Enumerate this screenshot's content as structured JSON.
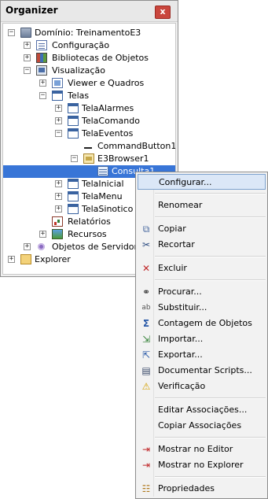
{
  "panel": {
    "title": "Organizer",
    "close_label": "x"
  },
  "tree": [
    {
      "label": "Domínio: TreinamentoE3",
      "expander": "−",
      "icon": "domain-icon"
    },
    {
      "label": "Configuração",
      "expander": "+",
      "icon": "config-icon"
    },
    {
      "label": "Bibliotecas de Objetos",
      "expander": "+",
      "icon": "library-icon"
    },
    {
      "label": "Visualização",
      "expander": "−",
      "icon": "visualization-icon"
    },
    {
      "label": "Viewer e Quadros",
      "expander": "+",
      "icon": "viewer-icon"
    },
    {
      "label": "Telas",
      "expander": "−",
      "icon": "screens-icon"
    },
    {
      "label": "TelaAlarmes",
      "expander": "+",
      "icon": "screen-icon"
    },
    {
      "label": "TelaComando",
      "expander": "+",
      "icon": "screen-icon"
    },
    {
      "label": "TelaEventos",
      "expander": "−",
      "icon": "screen-icon"
    },
    {
      "label": "CommandButton1",
      "expander": "",
      "icon": "command-button-icon"
    },
    {
      "label": "E3Browser1",
      "expander": "−",
      "icon": "browser-icon"
    },
    {
      "label": "Consulta1",
      "expander": "",
      "icon": "query-icon",
      "selected": true
    },
    {
      "label": "TelaInicial",
      "expander": "+",
      "icon": "screen-icon"
    },
    {
      "label": "TelaMenu",
      "expander": "+",
      "icon": "screen-icon"
    },
    {
      "label": "TelaSinotico",
      "expander": "+",
      "icon": "screen-icon"
    },
    {
      "label": "Relatórios",
      "expander": "",
      "icon": "report-icon"
    },
    {
      "label": "Recursos",
      "expander": "+",
      "icon": "resources-icon"
    },
    {
      "label": "Objetos de Servidor",
      "expander": "+",
      "icon": "server-objects-icon"
    },
    {
      "label": "Explorer",
      "expander": "+",
      "icon": "explorer-folder-icon"
    }
  ],
  "menu": {
    "items": [
      {
        "label": "Configurar...",
        "icon": "",
        "highlighted": true
      },
      {
        "label": "Renomear",
        "icon": ""
      },
      {
        "label": "Copiar",
        "icon": "copy-icon"
      },
      {
        "label": "Recortar",
        "icon": "cut-icon"
      },
      {
        "label": "Excluir",
        "icon": "delete-icon"
      },
      {
        "label": "Procurar...",
        "icon": "binoculars-icon"
      },
      {
        "label": "Substituir...",
        "icon": "replace-icon"
      },
      {
        "label": "Contagem de Objetos",
        "icon": "sigma-icon"
      },
      {
        "label": "Importar...",
        "icon": "import-icon"
      },
      {
        "label": "Exportar...",
        "icon": "export-icon"
      },
      {
        "label": "Documentar Scripts...",
        "icon": "book-icon"
      },
      {
        "label": "Verificação",
        "icon": "warning-icon"
      },
      {
        "label": "Editar Associações...",
        "icon": ""
      },
      {
        "label": "Copiar Associações",
        "icon": ""
      },
      {
        "label": "Mostrar no Editor",
        "icon": "show-editor-icon"
      },
      {
        "label": "Mostrar no Explorer",
        "icon": "show-explorer-icon"
      },
      {
        "label": "Propriedades",
        "icon": "properties-icon"
      }
    ]
  },
  "colors": {
    "selection": "#3875d7",
    "menu_highlight": "#dbe7f7",
    "close_button": "#c9463d"
  }
}
